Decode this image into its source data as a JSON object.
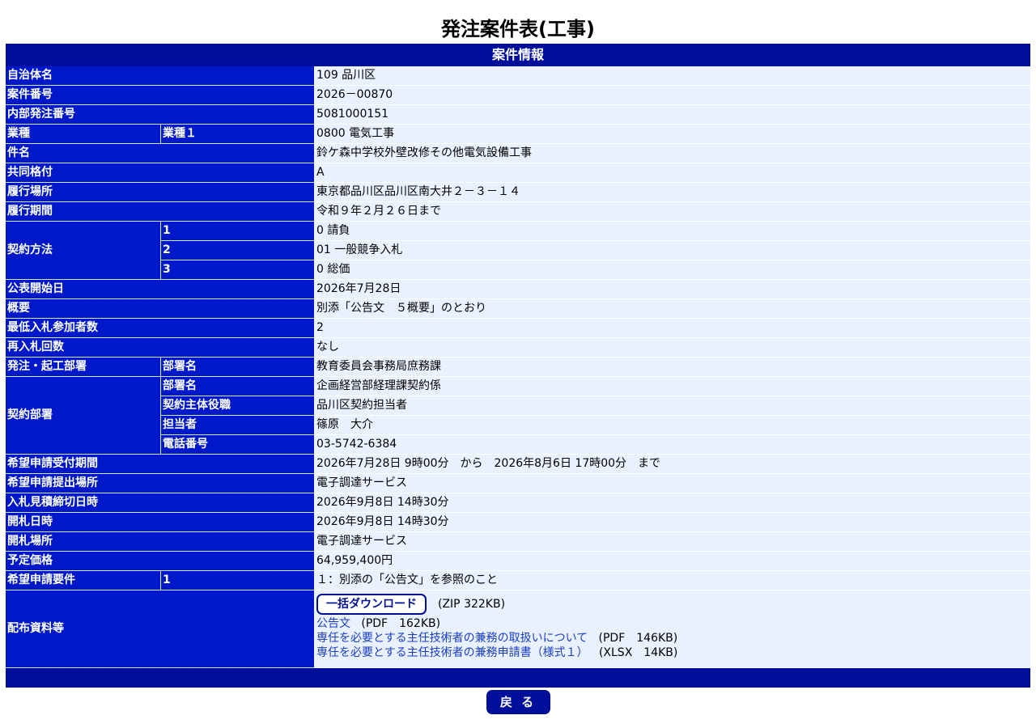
{
  "page": {
    "title": "発注案件表(工事)"
  },
  "section_header": "案件情報",
  "rows": {
    "jichitai": {
      "label": "自治体名",
      "value": "109 品川区"
    },
    "anken_no": {
      "label": "案件番号",
      "value": "2026－00870"
    },
    "naibu_no": {
      "label": "内部発注番号",
      "value": "5081000151"
    },
    "gyoshu": {
      "label": "業種",
      "sub": "業種１",
      "value": "0800 電気工事"
    },
    "kenmei": {
      "label": "件名",
      "value": "鈴ケ森中学校外壁改修その他電気設備工事"
    },
    "kyodo": {
      "label": "共同格付",
      "value": "A"
    },
    "basho": {
      "label": "履行場所",
      "value": "東京都品川区品川区南大井２－３－１４"
    },
    "kikan": {
      "label": "履行期間",
      "value": "令和９年２月２６日まで"
    },
    "keiyaku_hoho": {
      "label": "契約方法",
      "items": [
        {
          "sub": "1",
          "value": "0 請負"
        },
        {
          "sub": "2",
          "value": "01 一般競争入札"
        },
        {
          "sub": "3",
          "value": "0 総価"
        }
      ]
    },
    "kohyo": {
      "label": "公表開始日",
      "value": "2026年7月28日"
    },
    "gaiyo": {
      "label": "概要",
      "value": "別添「公告文　５概要」のとおり"
    },
    "saitei": {
      "label": "最低入札参加者数",
      "value": "2"
    },
    "sainyu": {
      "label": "再入札回数",
      "value": "なし"
    },
    "hacchu_busho": {
      "label": "発注・起工部署",
      "sub": "部署名",
      "value": "教育委員会事務局庶務課"
    },
    "keiyaku_busho": {
      "label": "契約部署",
      "items": [
        {
          "sub": "部署名",
          "value": "企画経営部経理課契約係"
        },
        {
          "sub": "契約主体役職",
          "value": "品川区契約担当者"
        },
        {
          "sub": "担当者",
          "value": "篠原　大介"
        },
        {
          "sub": "電話番号",
          "value": "03-5742-6384"
        }
      ]
    },
    "uketsuke": {
      "label": "希望申請受付期間",
      "value": "2026年7月28日 9時00分　から　2026年8月6日 17時00分　まで"
    },
    "teishutsu": {
      "label": "希望申請提出場所",
      "value": "電子調達サービス"
    },
    "shimekiri": {
      "label": "入札見積締切日時",
      "value": "2026年9月8日 14時30分"
    },
    "kaisatsu": {
      "label": "開札日時",
      "value": "2026年9月8日 14時30分"
    },
    "kaisatsu_basho": {
      "label": "開札場所",
      "value": "電子調達サービス"
    },
    "yotei": {
      "label": "予定価格",
      "value": "64,959,400円"
    },
    "yoken": {
      "label": "希望申請要件",
      "sub": "1",
      "value": "１：別添の「公告文」を参照のこと"
    },
    "haifu": {
      "label": "配布資料等",
      "download_label": "一括ダウンロード",
      "download_info": "(ZIP 322KB)",
      "docs": [
        {
          "name": "公告文",
          "info": "(PDF　162KB)"
        },
        {
          "name": "専任を必要とする主任技術者の兼務の取扱いについて",
          "info": "(PDF　146KB)"
        },
        {
          "name": "専任を必要とする主任技術者の兼務申請書（様式１）",
          "info": "(XLSX　14KB)"
        }
      ]
    }
  },
  "back_button": "戻 る",
  "colors": {
    "header": "#000f99",
    "label": "#0019c8",
    "value_bg": "#e8f1fd",
    "link": "#1a3cc8"
  }
}
